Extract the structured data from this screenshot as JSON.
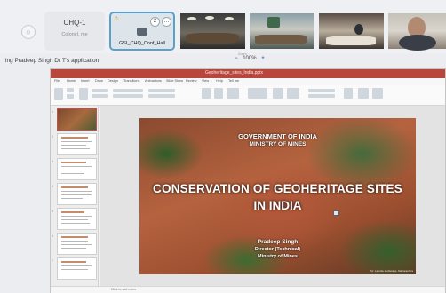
{
  "participants": [
    {
      "name": "CHQ-1",
      "subtitle": "Colonel, me"
    },
    {
      "name": "GSI_CHQ_Conf_Hall",
      "count": "2"
    }
  ],
  "presenter_text": "ing Pradeep Singh Dr T's application",
  "zoom": {
    "value": "100%",
    "minus": "−",
    "plus": "+",
    "caption": "Zoom"
  },
  "ppt": {
    "filename": "Geoheritage_sites_India.pptx",
    "tabs": [
      "File",
      "Home",
      "Insert",
      "Draw",
      "Design",
      "Transitions",
      "Animations",
      "Slide Show",
      "Review",
      "View",
      "Help",
      "Tell me"
    ],
    "notes_placeholder": "Click to add notes"
  },
  "slide": {
    "org_line1": "GOVERNMENT OF INDIA",
    "org_line2": "MINISTRY OF MINES",
    "title_line1": "CONSERVATION OF GEOHERITAGE SITES",
    "title_line2": "IN INDIA",
    "presenter_name": "Pradeep Singh",
    "presenter_role": "Director (Technical)",
    "presenter_org": "Ministry of Mines",
    "credit": "Pic: Laterite landscape, Maharashtra"
  },
  "thumbnails": [
    "1",
    "2",
    "3",
    "4",
    "5",
    "6",
    "7"
  ],
  "colors": {
    "accent": "#b8463d",
    "selected_border": "#5aa0c8",
    "zoom": "#2d6fb3"
  }
}
